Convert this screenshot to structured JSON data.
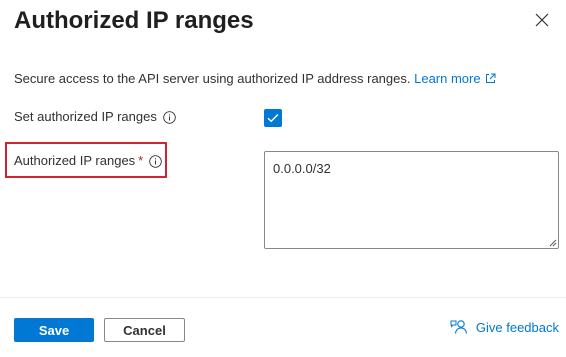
{
  "panel": {
    "title": "Authorized IP ranges",
    "close_icon": "close-icon",
    "description": "Secure access to the API server using authorized IP address ranges.",
    "learn_more_label": "Learn more"
  },
  "form": {
    "set_ranges_label": "Set authorized IP ranges",
    "set_ranges_checked": true,
    "ranges_label": "Authorized IP ranges",
    "ranges_required_marker": "*",
    "ranges_value": "0.0.0.0/32"
  },
  "footer": {
    "save_label": "Save",
    "cancel_label": "Cancel",
    "feedback_label": "Give feedback"
  },
  "colors": {
    "accent": "#0078d4",
    "highlight": "#d1242f",
    "required": "#a4262c"
  }
}
